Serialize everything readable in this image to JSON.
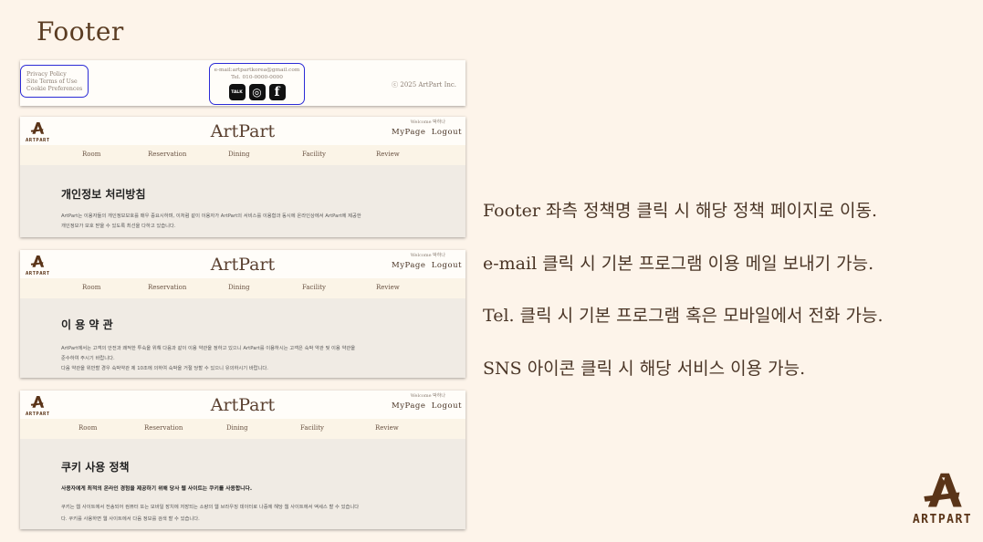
{
  "slide_title": "Footer",
  "footer": {
    "policies": [
      "Privacy Policy",
      "Site Terms of Use",
      "Cookie Preferences"
    ],
    "email": "e-mail:artpartkorea@gmail.com",
    "tel": "Tel. 010-0000-0000",
    "sns": [
      {
        "label": "TALK",
        "icon": "kakaotalk-icon"
      },
      {
        "label": "◎",
        "icon": "instagram-icon"
      },
      {
        "label": "f",
        "icon": "facebook-icon"
      }
    ],
    "copyright": "ⓒ 2025 ArtPart Inc."
  },
  "site": {
    "brand": "ArtPart",
    "logo_text": "ARTPART",
    "welcome": "Welcome 박하나",
    "mypage": "MyPage",
    "logout": "Logout",
    "nav": [
      "Room",
      "Reservation",
      "Dining",
      "Facility",
      "Review"
    ]
  },
  "pages": [
    {
      "title": "개인정보 처리방침",
      "lines": [
        "ArtPart는 이용자들의 개인정보보호를 매우 중요시하며, 이처럼 같이 이용자가 ArtPart의 서비스를 이용함과 동시에 온라인상에서 ArtPart에 제공한",
        "개인정보가 보호 받을 수 있도록 최선을 다하고 있습니다."
      ]
    },
    {
      "title": "이 용 약 관",
      "lines": [
        "ArtPart에서는 고객의 안전과 쾌적한 투숙을 위해 다음과 같이 이용 약관을 정하고 있으니 ArtPart를 이용하시는 고객은 숙박 약관 및 이용 약관을",
        "준수하여 주시기 바랍니다.",
        "다음 약관을 위반할 경우 숙박약관 제 10조에 의하여 숙박을 거절 당할 수 있으니 유의하시기 바랍니다."
      ]
    },
    {
      "title": "쿠키 사용 정책",
      "subtitle": "사용자에게 최적의 온라인 경험을 제공하기 위해 당사 웹 사이트는 쿠키를 사용합니다.",
      "lines": [
        "쿠키는 웹 사이트에서 전송되어 컴퓨터 또는 모바일 장치에 저장되는 소량의 웹 브라우징 데이터로 나중에 해당 웹 사이트에서 액세스 할 수 있습니다",
        "다. 쿠키를 사용하면 웹 사이트에서 다음 정보를 검색 할 수 있습니다."
      ]
    }
  ],
  "descriptions": [
    "Footer 좌측 정책명 클릭 시 해당 정책 페이지로 이동.",
    "e-mail 클릭 시 기본 프로그램 이용 메일 보내기 가능.",
    "Tel. 클릭 시 기본 프로그램 혹은 모바일에서 전화 가능.",
    "SNS 아이콘 클릭 시 해당 서비스 이용 가능."
  ],
  "brand_logo_text": "ARTPART"
}
